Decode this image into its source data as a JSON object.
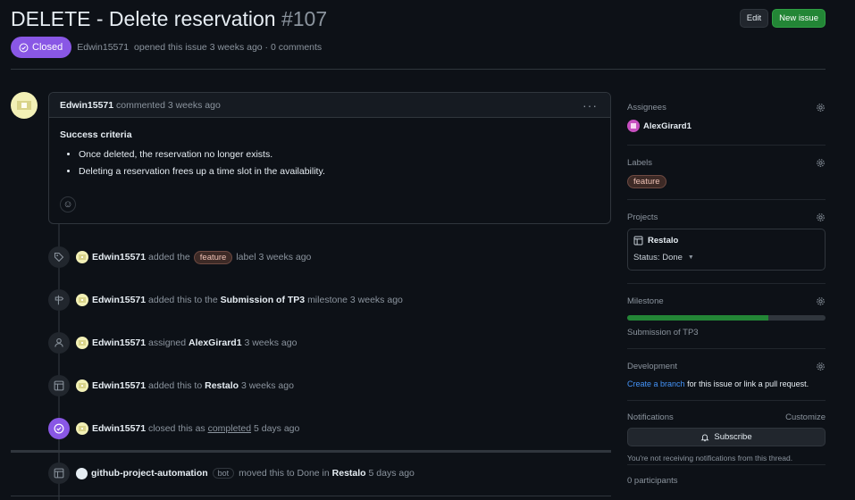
{
  "issue": {
    "title": "DELETE - Delete reservation",
    "number": "#107",
    "status": "Closed",
    "author": "Edwin15571",
    "opened_text": "opened this issue 3 weeks ago · 0 comments"
  },
  "header_buttons": {
    "edit": "Edit",
    "new_issue": "New issue"
  },
  "comment": {
    "author": "Edwin15571",
    "meta": "commented 3 weeks ago",
    "menu": "···",
    "heading": "Success criteria",
    "bullets": [
      "Once deleted, the reservation no longer exists.",
      "Deleting a reservation frees up a time slot in the availability."
    ]
  },
  "events": [
    {
      "actor": "Edwin15571",
      "pre": "added the",
      "label": "feature",
      "post": "label 3 weeks ago"
    },
    {
      "actor": "Edwin15571",
      "pre": "added this to the",
      "target": "Submission of TP3",
      "post": "milestone 3 weeks ago"
    },
    {
      "actor": "Edwin15571",
      "pre": "assigned",
      "target": "AlexGirard1",
      "post": "3 weeks ago"
    },
    {
      "actor": "Edwin15571",
      "pre": "added this to",
      "target": "Restalo",
      "post": "3 weeks ago"
    },
    {
      "actor": "Edwin15571",
      "pre": "closed this as",
      "target": "completed",
      "post": "5 days ago"
    },
    {
      "actor": "github-project-automation",
      "badge": "bot",
      "pre": "moved this to Done in",
      "target": "Restalo",
      "post": "5 days ago"
    }
  ],
  "sidebar": {
    "assignees": {
      "title": "Assignees",
      "user": "AlexGirard1"
    },
    "labels": {
      "title": "Labels",
      "label": "feature"
    },
    "projects": {
      "title": "Projects",
      "name": "Restalo",
      "status": "Status: Done"
    },
    "milestone": {
      "title": "Milestone",
      "name": "Submission of TP3",
      "progress": 0.71
    },
    "development": {
      "title": "Development",
      "link": "Create a branch",
      "text": "for this issue or link a pull request."
    },
    "notifications": {
      "title": "Notifications",
      "customize": "Customize",
      "subscribe": "Subscribe",
      "note": "You're not receiving notifications from this thread."
    },
    "participants": {
      "title": "0 participants"
    }
  },
  "colors": {
    "closed": "#8957e5",
    "green": "#238636",
    "link": "#4493f8",
    "bg": "#0d1117"
  }
}
